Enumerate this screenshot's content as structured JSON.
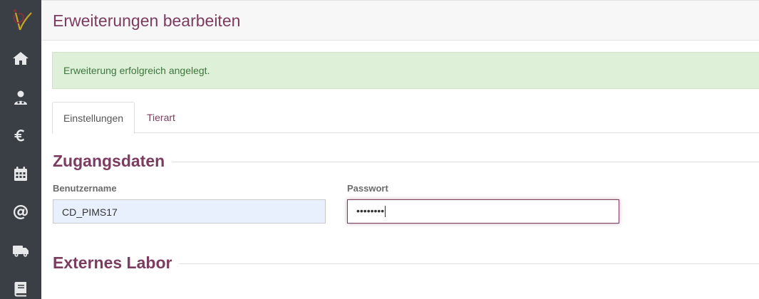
{
  "sidebar": {
    "items": [
      {
        "icon": "home-icon"
      },
      {
        "icon": "user-icon"
      },
      {
        "icon": "euro-icon"
      },
      {
        "icon": "calendar-icon"
      },
      {
        "icon": "at-icon"
      },
      {
        "icon": "truck-icon"
      },
      {
        "icon": "book-icon"
      }
    ]
  },
  "header": {
    "title": "Erweiterungen bearbeiten"
  },
  "alert": {
    "text": "Erweiterung erfolgreich angelegt."
  },
  "tabs": [
    {
      "label": "Einstellungen",
      "active": true
    },
    {
      "label": "Tierart",
      "active": false
    }
  ],
  "sections": {
    "access": "Zugangsdaten",
    "lab": "Externes Labor"
  },
  "form": {
    "username_label": "Benutzername",
    "username_value": "CD_PIMS17",
    "password_label": "Passwort",
    "password_value": "••••••••"
  },
  "colors": {
    "accent": "#7b3c5f",
    "sidebar": "#3a3f45",
    "alert_bg": "#dff0d8",
    "alert_text": "#3c763d"
  }
}
